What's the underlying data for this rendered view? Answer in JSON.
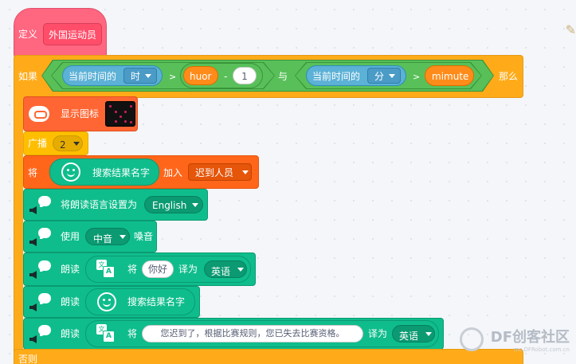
{
  "define_block": {
    "keyword": "定义",
    "name": "外国运动员"
  },
  "if_block": {
    "if_label": "如果",
    "and_label": "与",
    "then_label": "那么",
    "else_label": "否则",
    "cond1": {
      "reporter_label": "当前时间的",
      "dropdown": "时",
      "op": ">",
      "var": "huor",
      "minus": "-",
      "number": "1"
    },
    "cond2": {
      "reporter_label": "当前时间的",
      "dropdown": "分",
      "op": ">",
      "var": "mimute"
    }
  },
  "show_icon_block": {
    "label": "显示图标"
  },
  "broadcast_block": {
    "label": "广播",
    "value": "2"
  },
  "list_add_block": {
    "prefix": "将",
    "reporter": "搜索结果名字",
    "middle": "加入",
    "list": "迟到人员"
  },
  "tts_lang_block": {
    "label": "将朗读语言设置为",
    "value": "English"
  },
  "tts_voice_block": {
    "prefix": "使用",
    "value": "中音",
    "suffix": "嗓音"
  },
  "speak_translate_1": {
    "speak": "朗读",
    "prefix": "将",
    "text": "你好",
    "middle": "译为",
    "lang": "英语"
  },
  "speak_reporter": {
    "speak": "朗读",
    "reporter": "搜索结果名字"
  },
  "speak_translate_2": {
    "speak": "朗读",
    "prefix": "将",
    "text": "您迟到了，根据比赛规则，您已失去比赛资格。",
    "middle": "译为",
    "lang": "英语"
  },
  "watermark": {
    "brand": "DF创客社区",
    "url": "mc.DFRobot.com.cn"
  }
}
